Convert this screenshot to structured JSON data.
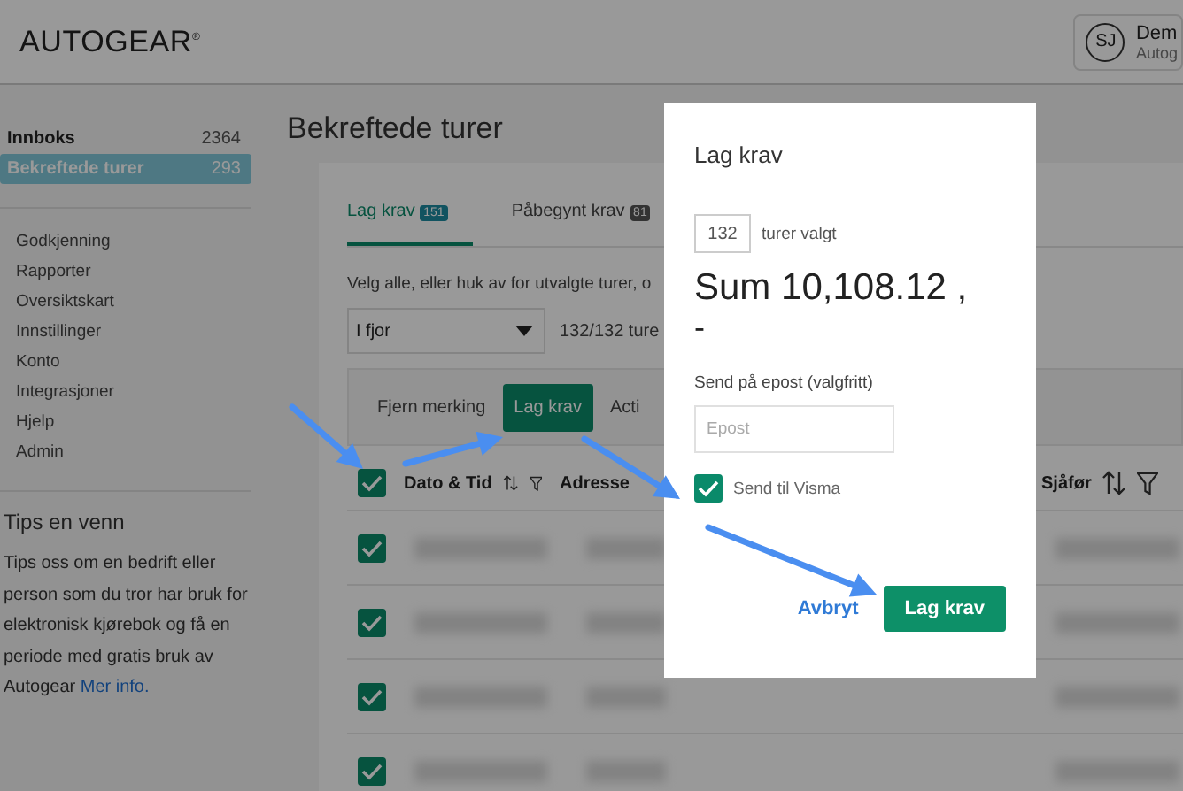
{
  "header": {
    "logo": "AUTOGEAR",
    "logo_mark": "®",
    "user": {
      "initials": "SJ",
      "name": "Dem",
      "company": "Autog"
    }
  },
  "sidebar": {
    "counters": [
      {
        "label": "Innboks",
        "count": "2364",
        "selected": false
      },
      {
        "label": "Bekreftede turer",
        "count": "293",
        "selected": true
      }
    ],
    "menu": [
      "Godkjenning",
      "Rapporter",
      "Oversiktskart",
      "Innstillinger",
      "Konto",
      "Integrasjoner",
      "Hjelp",
      "Admin"
    ],
    "tips": {
      "title": "Tips en venn",
      "text": "Tips oss om en bedrift eller person som du tror har bruk for elektronisk kjørebok og få en periode med gratis bruk av Autogear",
      "link": "Mer info."
    }
  },
  "main": {
    "title": "Bekreftede turer",
    "tabs": [
      {
        "label": "Lag krav",
        "count": "151",
        "selected": true
      },
      {
        "label": "Påbegynt krav",
        "count": "81",
        "selected": false
      }
    ],
    "instructions": "Velg alle, eller huk av for utvalgte turer, o",
    "period": "I fjor",
    "selection": "132/132 ture",
    "actions": [
      {
        "label": "Fjern merking",
        "kind": "plain"
      },
      {
        "label": "Lag krav",
        "kind": "primary"
      },
      {
        "label": "Acti",
        "kind": "plain"
      }
    ],
    "table": {
      "select_all": {
        "checked": true
      },
      "columns": [
        {
          "label": "Dato & Tid",
          "kind": "sortable"
        },
        {
          "label": "Adresse",
          "kind": "plain"
        },
        {
          "label": "Sjåfør",
          "kind": "sortable"
        }
      ],
      "rows": [
        {
          "checked": true
        },
        {
          "checked": true
        },
        {
          "checked": true
        },
        {
          "checked": true
        }
      ]
    }
  },
  "dialog": {
    "title": "Lag krav",
    "count": "132",
    "count_label": "turer valgt",
    "sum": "Sum 10,108.12 ,",
    "sum_suffix": "-",
    "email_label": "Send på epost (valgfritt)",
    "email_placeholder": "Epost",
    "visma": {
      "label": "Send til Visma",
      "checked": true
    },
    "cancel": "Avbryt",
    "confirm": "Lag krav"
  }
}
